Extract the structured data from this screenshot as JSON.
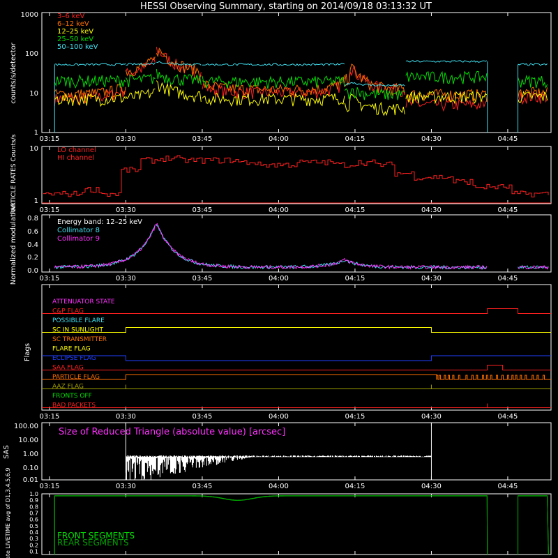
{
  "title": "HESSI Observing Summary, starting on 2014/09/18 03:13:32 UT",
  "time_ticks": [
    "03:15",
    "03:30",
    "03:45",
    "04:00",
    "04:15",
    "04:30",
    "04:45"
  ],
  "colors": {
    "white": "#ffffff",
    "red": "#ff2020",
    "orange": "#ff7000",
    "yellow": "#ffff00",
    "green": "#00e000",
    "cyan": "#40e0f0",
    "magenta": "#ff30ff",
    "blue": "#2040ff",
    "dark_green": "#00a000"
  },
  "chart_data": [
    {
      "type": "line",
      "name": "counts",
      "ylabel": "counts/s/detector",
      "scale": "log",
      "ylim": [
        1,
        1000
      ],
      "ytick_labels": [
        "1",
        "10",
        "100",
        "1000"
      ],
      "legend_placement": "top-left",
      "series": [
        {
          "name": "3–6 keV",
          "color": "#ff2020"
        },
        {
          "name": "6–12 keV",
          "color": "#ff7000"
        },
        {
          "name": "12–25 keV",
          "color": "#ffff00"
        },
        {
          "name": "25–50 keV",
          "color": "#00e000"
        },
        {
          "name": "50–100 keV",
          "color": "#40e0f0"
        }
      ],
      "segments": [
        {
          "t0": "03:16",
          "t1": "03:30",
          "levels": {
            "50-100": 50,
            "25-50": 20,
            "12-25": 7,
            "6-12": 9,
            "3-6": 7
          }
        },
        {
          "t0": "03:30",
          "t1": "03:36",
          "levels": {
            "50-100": 50,
            "25-50": 20,
            "12-25": 7,
            "6-12": 30,
            "3-6": 25
          }
        },
        {
          "t0": "03:36",
          "t1": "03:45",
          "levels": {
            "50-100": 50,
            "25-50": 20,
            "12-25": 8,
            "6-12": 30,
            "3-6": 25
          }
        },
        {
          "t0": "03:45",
          "t1": "04:13",
          "levels": {
            "50-100": 50,
            "25-50": 19,
            "12-25": 7,
            "6-12": 12,
            "3-6": 10
          }
        },
        {
          "t0": "04:13",
          "t1": "04:25",
          "levels": {
            "50-100": 15,
            "25-50": 9,
            "12-25": 4,
            "6-12": 12,
            "3-6": 12
          }
        },
        {
          "t0": "04:25",
          "t1": "04:41",
          "levels": {
            "50-100": 60,
            "25-50": 25,
            "12-25": 8,
            "6-12": 9,
            "3-6": 5
          }
        },
        {
          "t0": "04:47",
          "t1": "04:53",
          "levels": {
            "50-100": 50,
            "25-50": 20,
            "12-25": 8,
            "6-12": 10,
            "3-6": 8
          }
        }
      ],
      "peaks": [
        {
          "t": "03:36",
          "value": 95
        },
        {
          "t": "04:14",
          "value": 35
        }
      ]
    },
    {
      "type": "line",
      "name": "particle_rates",
      "ylabel": "PARTICLE RATES Counts/s",
      "ylim": [
        0,
        10
      ],
      "ytick_labels": [
        "1",
        "10"
      ],
      "series": [
        {
          "name": "LO channel",
          "color": "#ff2020"
        },
        {
          "name": "HI channel",
          "color": "#ff2020"
        }
      ],
      "lo_levels": [
        1.5,
        1.5,
        1.8,
        1.5,
        4,
        6,
        6.5,
        6,
        6,
        6,
        5.5,
        5,
        5,
        5.5,
        5.5,
        5,
        5.5,
        5,
        3.5,
        3,
        3,
        2.5,
        2,
        2,
        1.5,
        1.5
      ]
    },
    {
      "type": "line",
      "name": "modulation",
      "ylabel": "Normalized modulation",
      "ylim": [
        0,
        0.8
      ],
      "ytick_labels": [
        "0.0",
        "0.2",
        "0.4",
        "0.6",
        "0.8"
      ],
      "annotation": "Energy band: 12–25 keV",
      "series": [
        {
          "name": "Collimator 8",
          "color": "#40e0f0"
        },
        {
          "name": "Collimator 9",
          "color": "#ff30ff"
        }
      ],
      "baseline": 0.07,
      "peaks": [
        {
          "t": "03:36",
          "value": 0.72
        },
        {
          "t": "04:13",
          "value": 0.18
        }
      ],
      "gaps": [
        [
          "04:41",
          "04:47"
        ]
      ]
    },
    {
      "type": "line",
      "name": "flags",
      "ylabel": "Flags",
      "series": [
        {
          "name": "ATTENUATOR STATE",
          "color": "#ff30ff"
        },
        {
          "name": "C&P FLAG",
          "color": "#ff2020"
        },
        {
          "name": "POSSIBLE FLARE",
          "color": "#40e0f0"
        },
        {
          "name": "SC IN SUNLIGHT",
          "color": "#ffff00"
        },
        {
          "name": "SC TRANSMITTER",
          "color": "#ff7000"
        },
        {
          "name": "FLARE FLAG",
          "color": "#ffff00"
        },
        {
          "name": "ECLIPSE FLAG",
          "color": "#2040ff"
        },
        {
          "name": "SAA FLAG",
          "color": "#ff2020"
        },
        {
          "name": "PARTICLE FLAG",
          "color": "#ff7000"
        },
        {
          "name": "AAZ FLAG",
          "color": "#a0a000"
        },
        {
          "name": "FRONTS OFF",
          "color": "#00e000"
        },
        {
          "name": "BAD PACKETS",
          "color": "#ff2020"
        }
      ]
    },
    {
      "type": "line",
      "name": "sas",
      "ylabel": "SAS",
      "scale": "log",
      "ylim": [
        0.01,
        100
      ],
      "ytick_labels": [
        "0.01",
        "0.10",
        "1.00",
        "10.00",
        "100.00"
      ],
      "annotation": "Size of Reduced Triangle (absolute value) [arcsec]",
      "level": 0.4,
      "active": [
        "03:30",
        "04:30"
      ]
    },
    {
      "type": "line",
      "name": "livetime",
      "ylabel": "Mon. Rate LIVETIME avg of D1,3,4,5,6,9",
      "ylim": [
        0.1,
        1.0
      ],
      "ytick_labels": [
        "1.0",
        "0.9",
        "0.8",
        "0.7",
        "0.6",
        "0.5",
        "0.4",
        "0.3",
        "0.2",
        "0.1"
      ],
      "series": [
        {
          "name": "FRONT SEGMENTS",
          "color": "#00e000"
        },
        {
          "name": "REAR SEGMENTS",
          "color": "#00a000"
        }
      ],
      "level": 0.97,
      "dip": {
        "t": "03:52",
        "value": 0.9
      },
      "active": [
        [
          "03:16",
          "04:41"
        ],
        [
          "04:47",
          "04:53"
        ]
      ]
    }
  ]
}
